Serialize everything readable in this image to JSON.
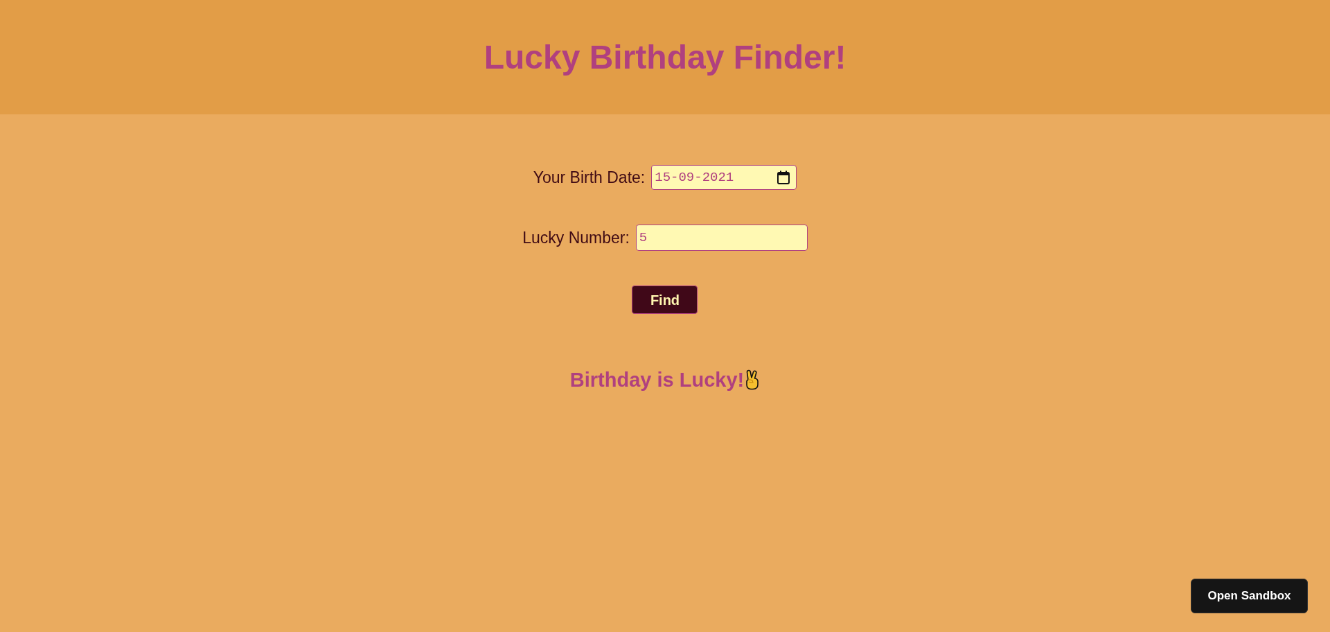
{
  "header": {
    "title": "Lucky Birthday Finder!"
  },
  "form": {
    "fields": [
      {
        "kind": "date",
        "label": "Your Birth Date:",
        "value": "15-09-2021"
      },
      {
        "kind": "number",
        "label": "Lucky Number:",
        "value": "5"
      }
    ],
    "button": "Find"
  },
  "result": {
    "message": "Birthday is Lucky!"
  },
  "sandbox_button": "Open Sandbox"
}
